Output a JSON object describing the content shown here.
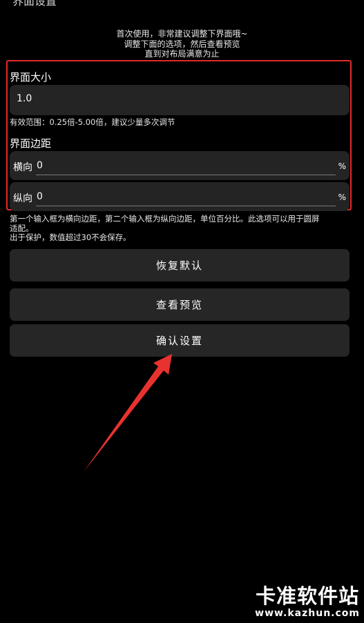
{
  "window": {
    "title": "界面设置"
  },
  "intro": {
    "lines": [
      "首次使用，非常建议调整下界面哦~",
      "调整下面的选项，然后查看预览",
      "直到对布局满意为止"
    ]
  },
  "size_section": {
    "label": "界面大小",
    "value": "1.0",
    "hint": "有效范围：0.25倍-5.00倍，建议少量多次调节"
  },
  "margin_section": {
    "label": "界面边距",
    "horizontal": {
      "label": "横向",
      "value": "0",
      "unit": "%"
    },
    "vertical": {
      "label": "纵向",
      "value": "0",
      "unit": "%"
    }
  },
  "note": {
    "lines": [
      "第一个输入框为横向边距，第二个输入框为纵向边距，单位百分比。此选项可以用于圆屏",
      "适配。",
      "出于保护，数值超过30不会保存。"
    ]
  },
  "buttons": {
    "reset": "恢复默认",
    "preview": "查看预览",
    "confirm": "确认设置"
  },
  "watermark": {
    "title": "卡准软件站",
    "url": "www.kazhun.com"
  },
  "colors": {
    "background": "#000000",
    "field": "#242424",
    "button": "#262626",
    "highlight": "#e5292b",
    "arrow": "#e8322f"
  }
}
